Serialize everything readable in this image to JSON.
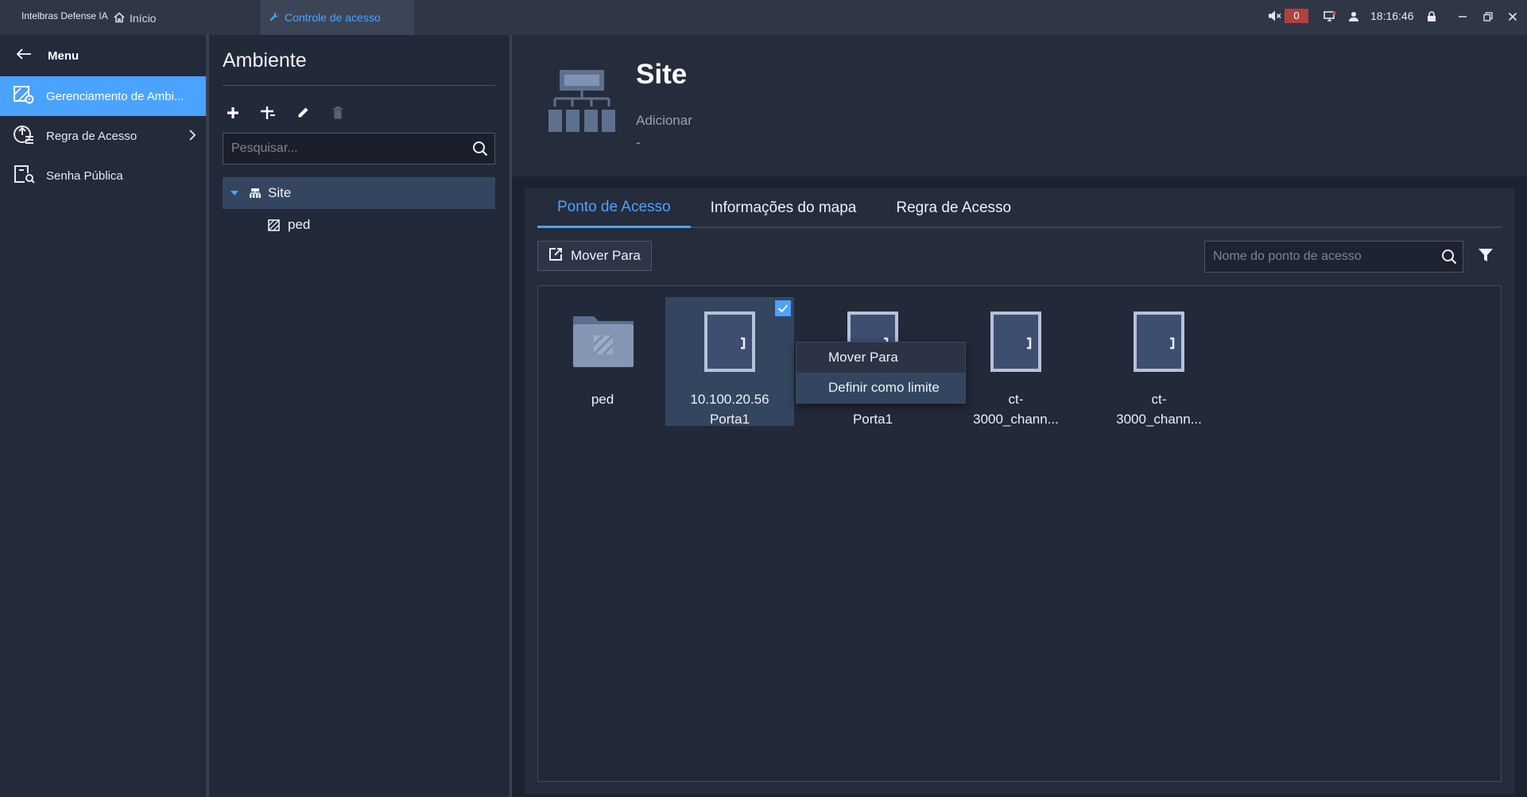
{
  "titlebar": {
    "app_name": "Intelbras Defense IA",
    "tab_home": "Início",
    "tab_access": "Controle de acesso",
    "alarm_count": "0",
    "clock": "18:16:46"
  },
  "menu": {
    "header": "Menu",
    "items": [
      {
        "label": "Gerenciamento de Ambi...",
        "icon": "map-edit-icon",
        "active": true
      },
      {
        "label": "Regra de Acesso",
        "icon": "access-rule-icon",
        "active": false
      },
      {
        "label": "Senha Pública",
        "icon": "public-password-icon",
        "active": false
      }
    ]
  },
  "ambiente": {
    "title": "Ambiente",
    "search_placeholder": "Pesquisar...",
    "tree": [
      {
        "label": "Site",
        "icon": "site-icon",
        "selected": true
      },
      {
        "label": "ped",
        "icon": "area-icon",
        "selected": false
      }
    ]
  },
  "site": {
    "title": "Site",
    "subtitle": "Adicionar",
    "detail": "-"
  },
  "tabs": [
    "Ponto de Acesso",
    "Informações do mapa",
    "Regra de Acesso"
  ],
  "toolbar": {
    "move_label": "Mover Para",
    "search_placeholder": "Nome do ponto de acesso"
  },
  "tiles": [
    {
      "type": "folder",
      "line1": "ped",
      "line2": "",
      "selected": false
    },
    {
      "type": "door",
      "line1": "10.100.20.56",
      "line2": "Porta1",
      "selected": true
    },
    {
      "type": "door",
      "line1": "",
      "line2": "Porta1",
      "selected": false
    },
    {
      "type": "door",
      "line1": "ct-",
      "line2": "3000_chann...",
      "selected": false
    },
    {
      "type": "door",
      "line1": "ct-",
      "line2": "3000_chann...",
      "selected": false
    }
  ],
  "context_menu": {
    "items": [
      "Mover Para",
      "Definir como limite"
    ],
    "highlighted_index": 1
  },
  "colors": {
    "accent": "#4aa3ff",
    "selection": "#34465f",
    "alarm": "#b3403c"
  }
}
